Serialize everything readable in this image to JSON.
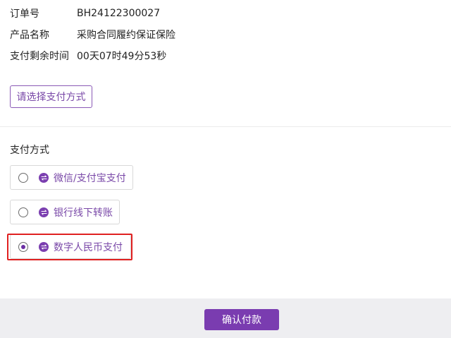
{
  "order_info": {
    "order_no_label": "订单号",
    "order_no_value": "BH24122300027",
    "product_label": "产品名称",
    "product_value": "采购合同履约保证保险",
    "remaining_label": "支付剩余时间",
    "remaining_value": "00天07时49分53秒"
  },
  "select_method_button": "请选择支付方式",
  "payment_section": {
    "title": "支付方式",
    "options": [
      {
        "label": "微信/支付宝支付",
        "selected": false,
        "icon": "transfer-icon"
      },
      {
        "label": "银行线下转账",
        "selected": false,
        "icon": "transfer-icon"
      },
      {
        "label": "数字人民币支付",
        "selected": true,
        "icon": "transfer-icon"
      }
    ]
  },
  "footer": {
    "confirm_label": "确认付款"
  },
  "colors": {
    "accent": "#7a3cb0",
    "highlight": "#e02020"
  }
}
